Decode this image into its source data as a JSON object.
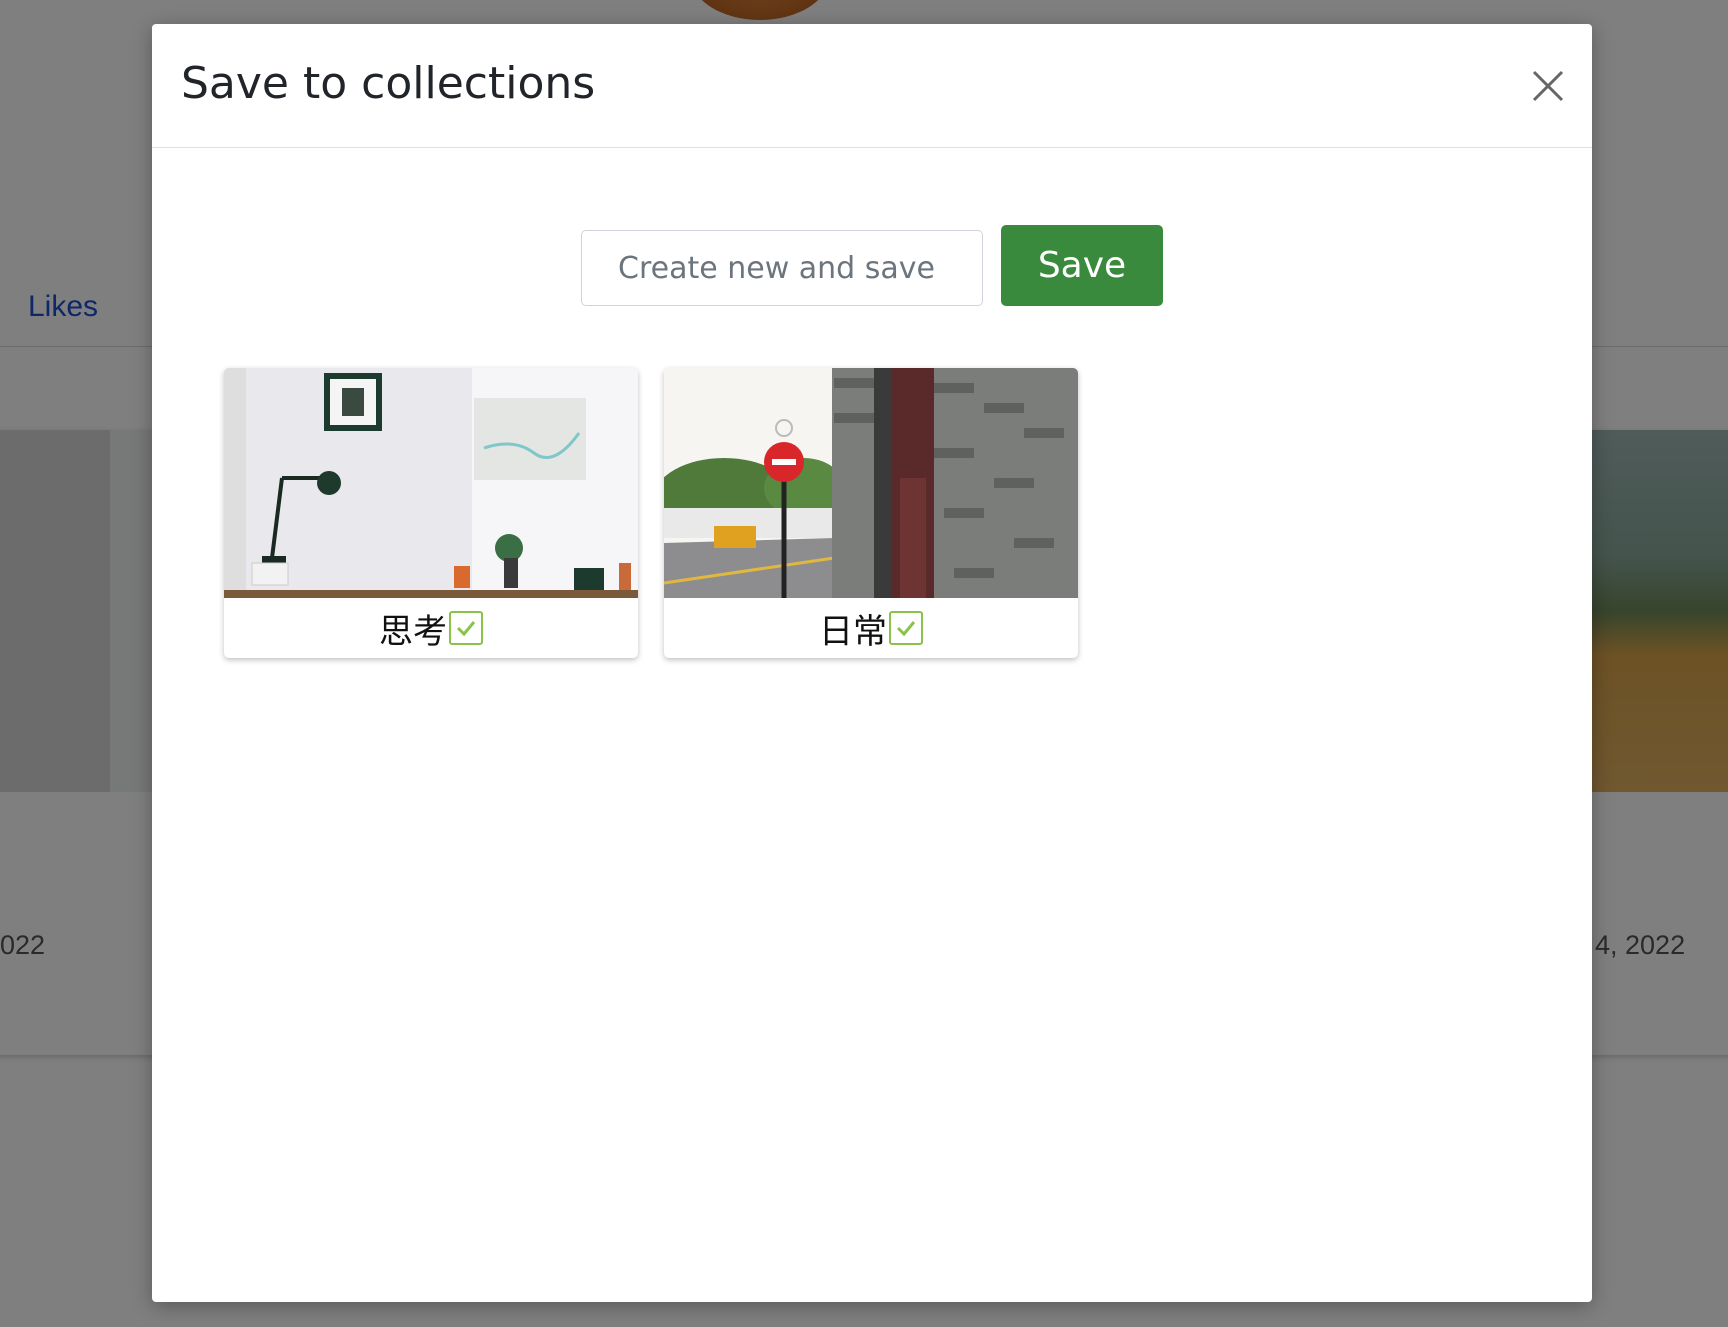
{
  "background": {
    "tab_label": "Likes",
    "date_left": "022",
    "date_right": "4, 2022"
  },
  "modal": {
    "title": "Save to collections",
    "close_icon": "close-icon",
    "create_input": {
      "placeholder": "Create new and save",
      "value": ""
    },
    "save_label": "Save",
    "collections": [
      {
        "name": "思考",
        "checked": true,
        "thumbnail": "desk-lamp-photo"
      },
      {
        "name": "日常",
        "checked": true,
        "thumbnail": "street-no-entry-photo"
      }
    ]
  },
  "colors": {
    "save_button": "#3a8a3e",
    "checkbox": "#8bc34a",
    "link": "#1a4fd1"
  }
}
